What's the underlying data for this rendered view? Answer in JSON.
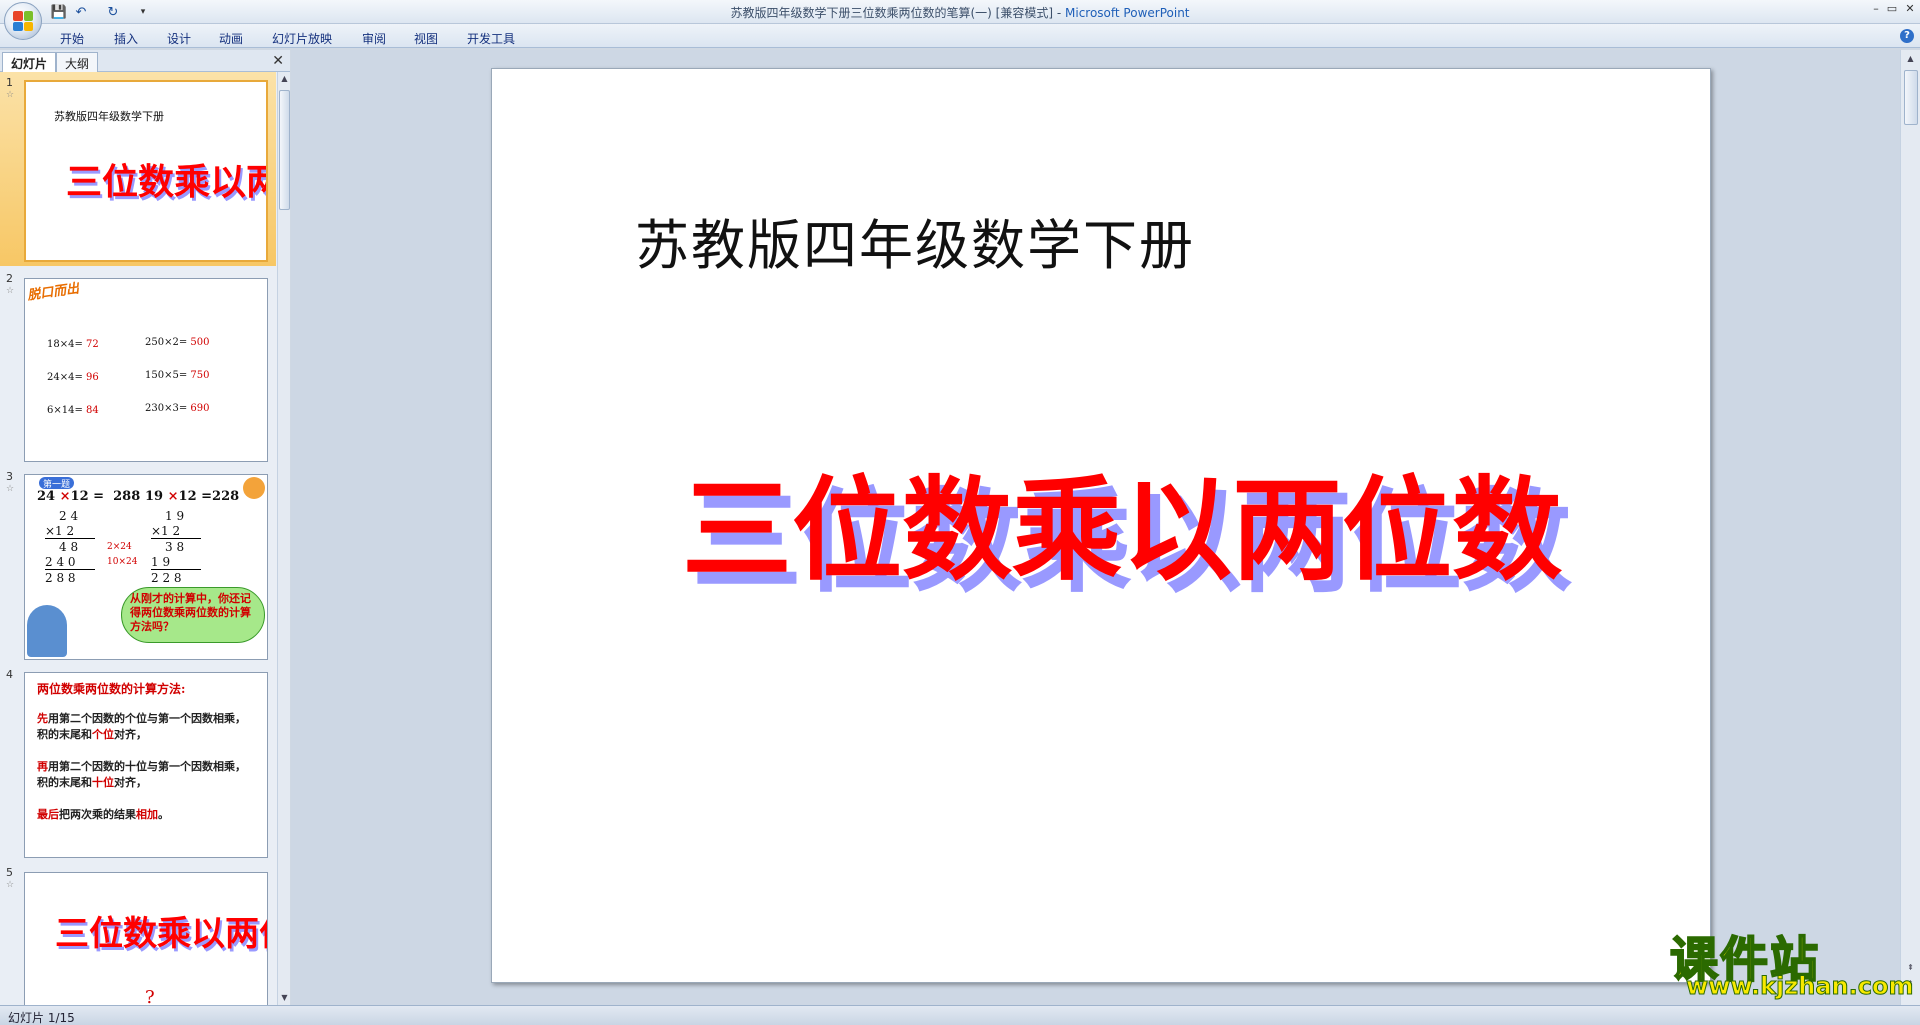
{
  "window": {
    "title_prefix": "苏教版四年级数学下册三位数乘两位数的笔算(一) [兼容模式] - ",
    "app_name": "Microsoft PowerPoint",
    "minimize": "–",
    "restore": "▭",
    "close": "✕"
  },
  "qat": {
    "save": "💾",
    "undo": "↶",
    "redo": "↻",
    "customize": "▾"
  },
  "ribbon": {
    "tabs": [
      "开始",
      "插入",
      "设计",
      "动画",
      "幻灯片放映",
      "审阅",
      "视图",
      "开发工具"
    ],
    "help": "?"
  },
  "left_pane": {
    "tabs": [
      "幻灯片",
      "大纲"
    ],
    "close": "✕"
  },
  "thumbnails": [
    {
      "num": "1",
      "subtitle": "苏教版四年级数学下册",
      "title": "三位数乘以两位数"
    },
    {
      "num": "2",
      "badge": "脱口而出",
      "left": [
        {
          "expr": "18×4=",
          "ans": "72"
        },
        {
          "expr": "24×4=",
          "ans": "96"
        },
        {
          "expr": "6×14=",
          "ans": "84"
        }
      ],
      "right": [
        {
          "expr": "250×2=",
          "ans": "500"
        },
        {
          "expr": "150×5=",
          "ans": "750"
        },
        {
          "expr": "230×3=",
          "ans": "690"
        }
      ]
    },
    {
      "num": "3",
      "badge": "第一题",
      "eq1_a": "24",
      "eq1_op": "×",
      "eq1_b": "12 =",
      "eq1_r": "288",
      "eq2_a": "19",
      "eq2_op": "×",
      "eq2_b": "12 =228",
      "c1_top": "2 4",
      "c1_mul": "×1 2",
      "c1_p1": "4 8",
      "c1_p2": "2 4 0",
      "c1_sum": "2 8 8",
      "c1_note1": "2×24",
      "c1_note2": "10×24",
      "c2_top": "1 9",
      "c2_mul": "×1 2",
      "c2_p1": "3 8",
      "c2_p2": "1 9",
      "c2_sum": "2 2 8",
      "bubble": "从刚才的计算中，你还记得两位数乘两位数的计算方法吗？"
    },
    {
      "num": "4",
      "heading": "两位数乘两位数的计算方法:",
      "p1_lead": "先",
      "p1_a": "用第二个因数的个位与第一个因数相乘，积的末尾和",
      "p1_hl": "个位",
      "p1_end": "对齐，",
      "p2_lead": "再",
      "p2_a": "用第二个因数的十位与第一个因数相乘，积的末尾和",
      "p2_hl": "十位",
      "p2_end": "对齐，",
      "p3_lead": "最后",
      "p3_a": "把两次乘的结果",
      "p3_hl": "相加",
      "p3_end": "。"
    },
    {
      "num": "5",
      "title": "三位数乘以两位数",
      "mark": "?"
    }
  ],
  "slide": {
    "subtitle": "苏教版四年级数学下册",
    "wordart": "三位数乘以两位数",
    "wordart_fill": "#ff0000",
    "wordart_shadow": "#9999ff"
  },
  "status": {
    "text": "幻灯片 1/15"
  },
  "watermark": {
    "main": "课件站",
    "url": "www.kjzhan.com"
  }
}
